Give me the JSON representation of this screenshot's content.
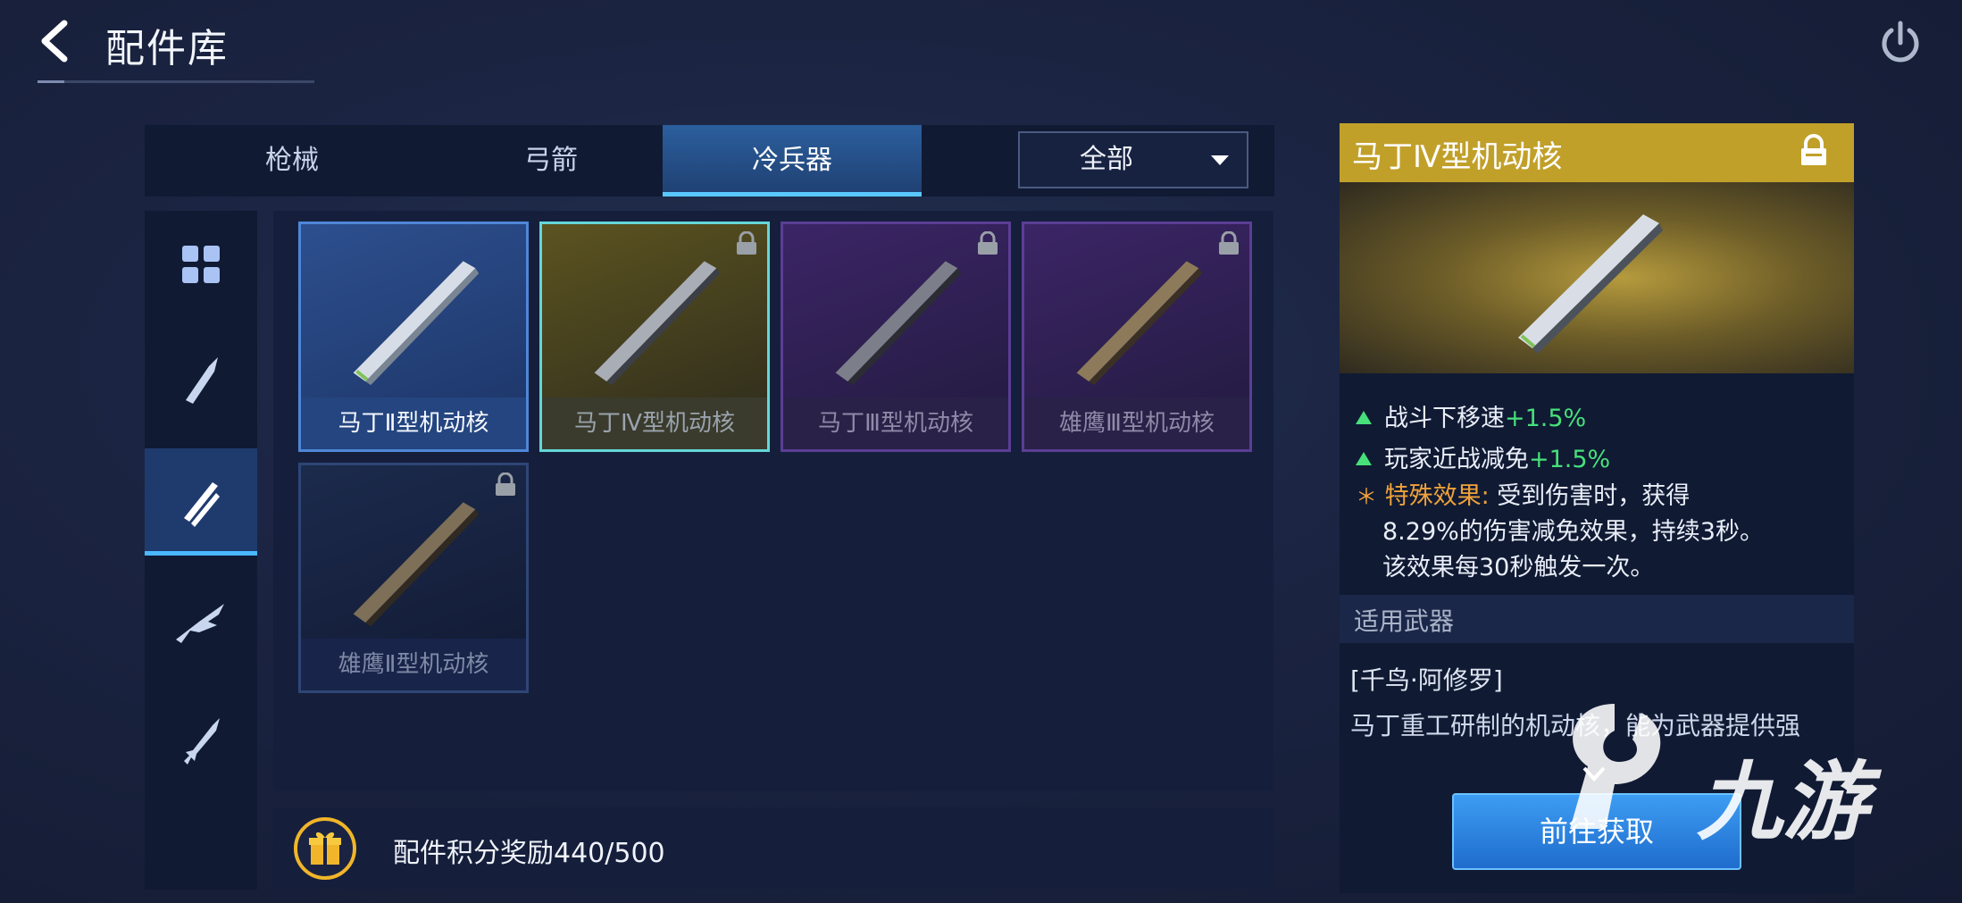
{
  "header": {
    "title": "配件库"
  },
  "tabs": [
    {
      "label": "枪械",
      "active": false
    },
    {
      "label": "弓箭",
      "active": false
    },
    {
      "label": "冷兵器",
      "active": true
    }
  ],
  "filter": {
    "selected": "全部"
  },
  "side_nav": [
    {
      "icon": "grid-icon",
      "active": false
    },
    {
      "icon": "blade-icon",
      "active": false
    },
    {
      "icon": "dual-blade-icon",
      "active": true
    },
    {
      "icon": "wing-blade-icon",
      "active": false
    },
    {
      "icon": "sword-icon",
      "active": false
    }
  ],
  "items": [
    {
      "name": "马丁Ⅱ型机动核",
      "rarity": "blue",
      "locked": false,
      "selected": false
    },
    {
      "name": "马丁Ⅳ型机动核",
      "rarity": "gold",
      "locked": true,
      "selected": true
    },
    {
      "name": "马丁Ⅲ型机动核",
      "rarity": "purple",
      "locked": true,
      "selected": false
    },
    {
      "name": "雄鹰Ⅲ型机动核",
      "rarity": "purple",
      "locked": true,
      "selected": false
    },
    {
      "name": "雄鹰Ⅱ型机动核",
      "rarity": "navy",
      "locked": true,
      "selected": false
    }
  ],
  "reward": {
    "label": "配件积分奖励440/500"
  },
  "detail": {
    "title": "马丁Ⅳ型机动核",
    "stats": [
      {
        "label": "战斗下移速",
        "value": "+1.5%"
      },
      {
        "label": "玩家近战减免",
        "value": "+1.5%"
      }
    ],
    "special_label": "特殊效果:",
    "special_line1": "受到伤害时，获得",
    "special_line2": "8.29%的伤害减免效果，持续3秒。",
    "special_line3": "该效果每30秒触发一次。",
    "section_title": "适用武器",
    "weapon": "[千鸟·阿修罗]",
    "lore": "马丁重工研制的机动核，能为武器提供强",
    "action_label": "前往获取"
  },
  "watermark": {
    "text": "九游"
  },
  "colors": {
    "accent": "#4ab8ff",
    "gold": "#c1a02a",
    "green": "#47e07a",
    "orange": "#f0a23a"
  }
}
